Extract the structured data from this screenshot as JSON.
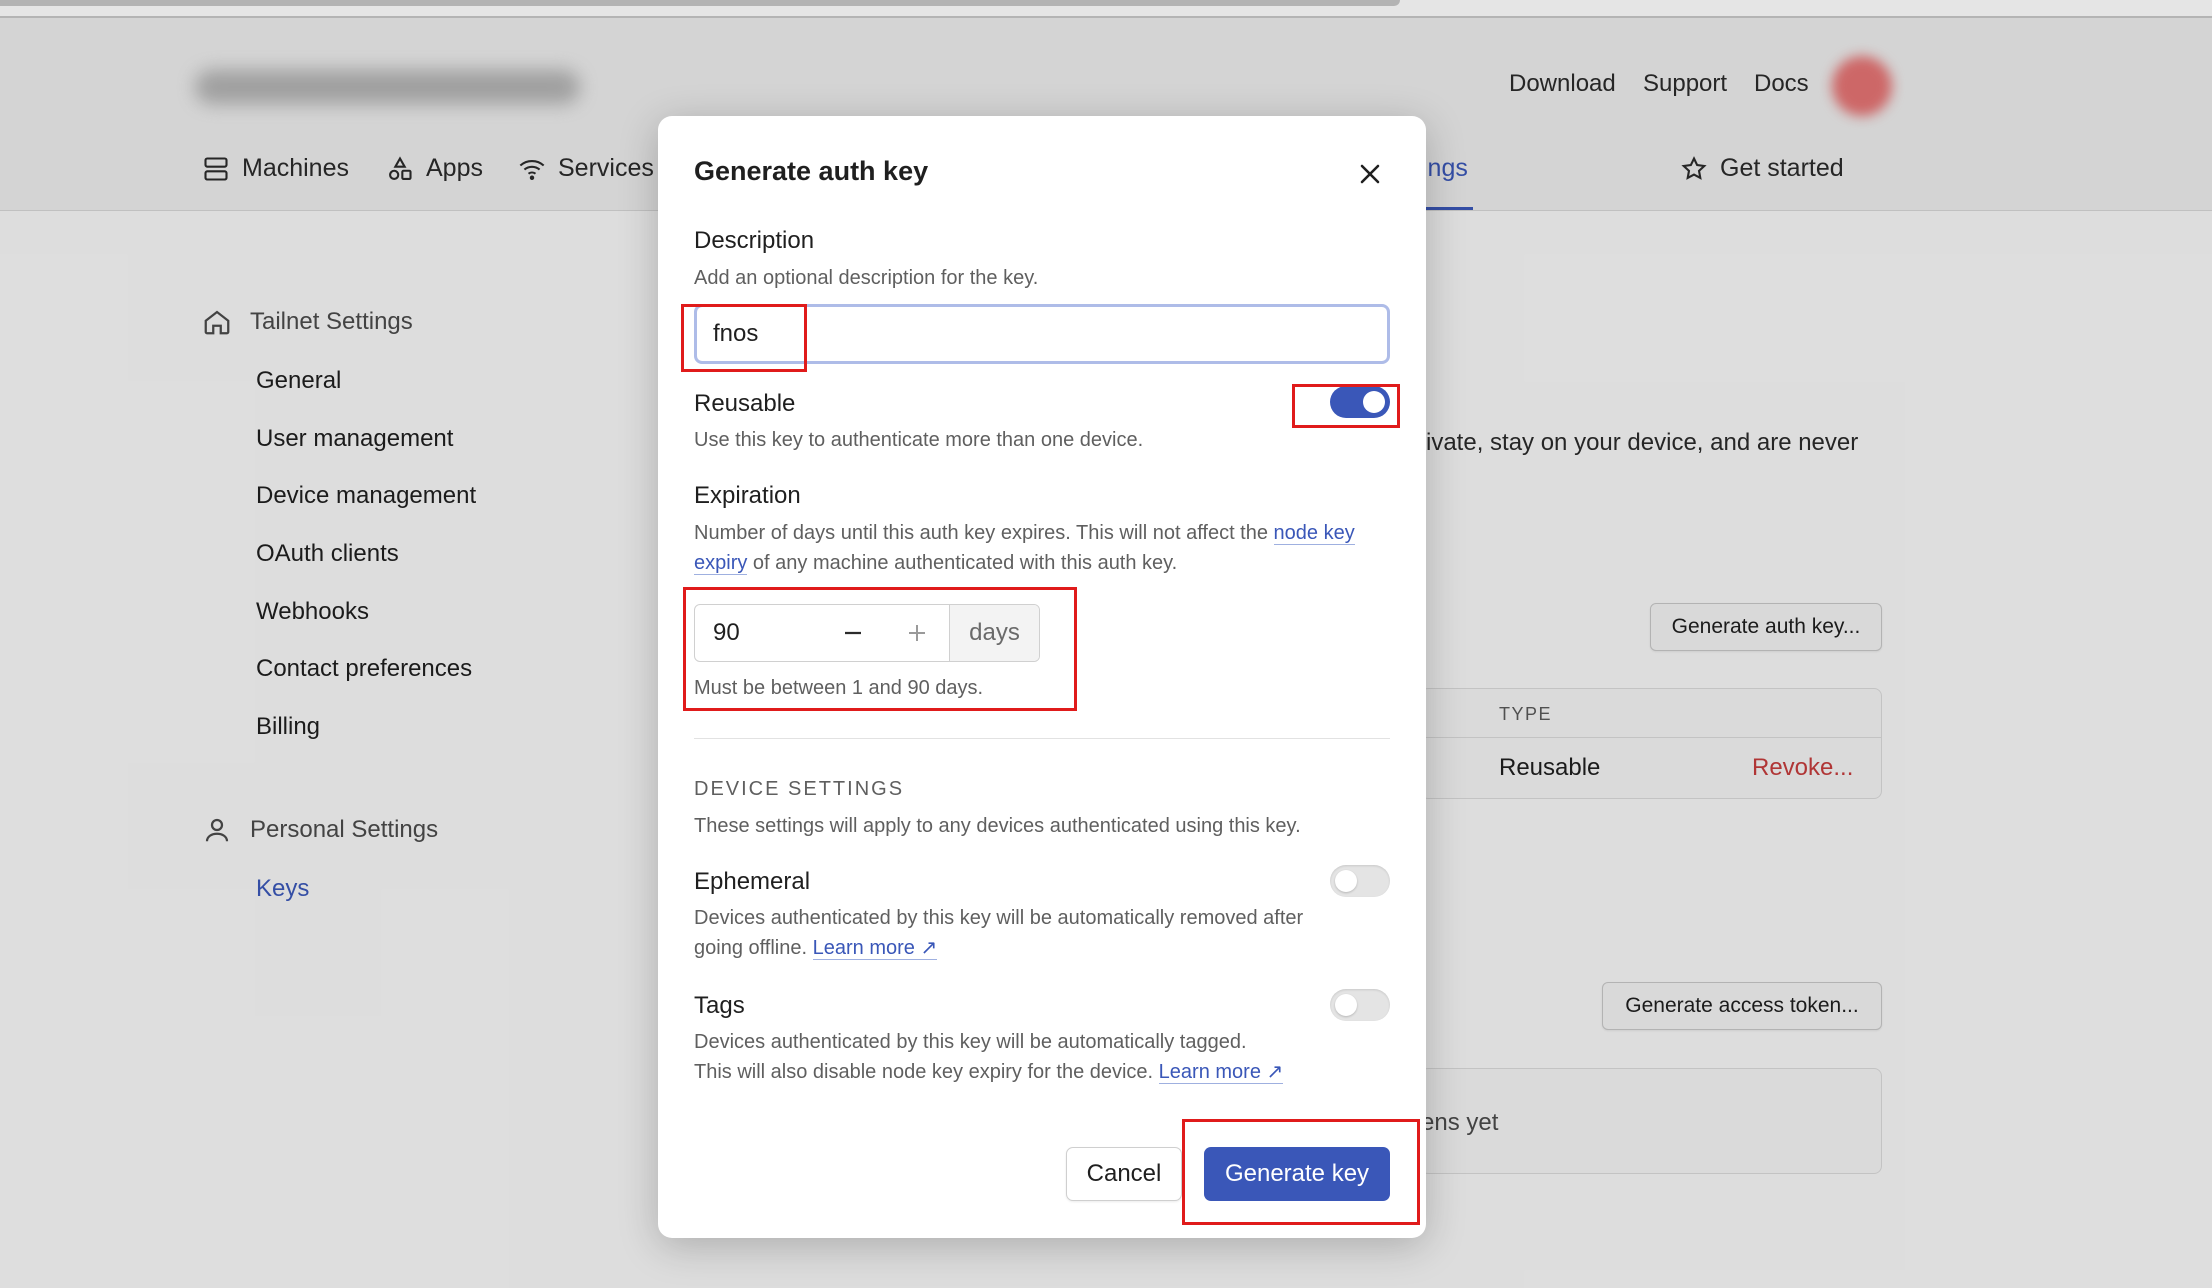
{
  "header": {
    "links": [
      "Download",
      "Support",
      "Docs"
    ],
    "nav": [
      {
        "label": "Machines",
        "icon": "server-icon"
      },
      {
        "label": "Apps",
        "icon": "apps-icon"
      },
      {
        "label": "Services",
        "icon": "wifi-icon"
      },
      {
        "label": "ings",
        "icon": ""
      },
      {
        "label": "Get started",
        "icon": "star-icon"
      }
    ]
  },
  "sidebar": {
    "tailnet_title": "Tailnet Settings",
    "tailnet_items": [
      "General",
      "User management",
      "Device management",
      "OAuth clients",
      "Webhooks",
      "Contact preferences",
      "Billing"
    ],
    "personal_title": "Personal Settings",
    "personal_items": [
      "Keys"
    ]
  },
  "background": {
    "privacy_fragment": "rivate, stay on your device, and are never",
    "generate_auth_btn": "Generate auth key...",
    "type_header": "TYPE",
    "type_value": "Reusable",
    "revoke": "Revoke...",
    "generate_access_btn": "Generate access token...",
    "empty_fragment": "ens yet"
  },
  "modal": {
    "title": "Generate auth key",
    "description": {
      "label": "Description",
      "help": "Add an optional description for the key.",
      "value": "fnos"
    },
    "reusable": {
      "label": "Reusable",
      "help": "Use this key to authenticate more than one device.",
      "on": true
    },
    "expiration": {
      "label": "Expiration",
      "help_1": "Number of days until this auth key expires. This will not affect the ",
      "help_link": "node key expiry",
      "help_2": " of any machine authenticated with this auth key.",
      "value": "90",
      "unit": "days",
      "hint": "Must be between 1 and 90 days."
    },
    "device_settings": {
      "title": "DEVICE SETTINGS",
      "help": "These settings will apply to any devices authenticated using this key."
    },
    "ephemeral": {
      "label": "Ephemeral",
      "help": "Devices authenticated by this key will be automatically removed after going offline. ",
      "link": "Learn more ↗",
      "on": false
    },
    "tags": {
      "label": "Tags",
      "help_line1": "Devices authenticated by this key will be automatically tagged.",
      "help_line2": "This will also disable node key expiry for the device. ",
      "link": "Learn more ↗",
      "on": false
    },
    "cancel_label": "Cancel",
    "generate_label": "Generate key"
  },
  "colors": {
    "accent": "#3a57b8",
    "highlight": "#e01b1b",
    "danger": "#c43c3c"
  }
}
